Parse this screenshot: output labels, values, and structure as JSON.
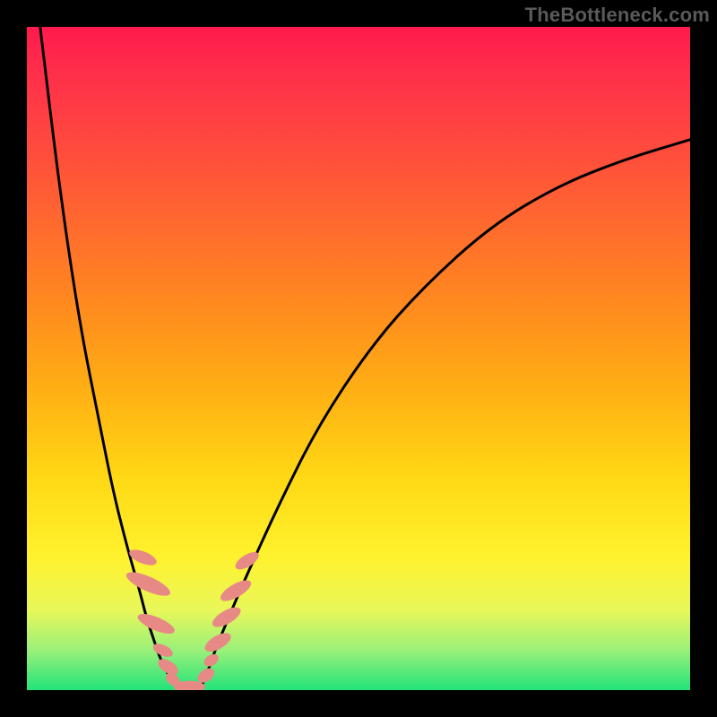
{
  "watermark": {
    "text": "TheBottleneck.com"
  },
  "chart_data": {
    "type": "line",
    "title": "",
    "xlabel": "",
    "ylabel": "",
    "xlim": [
      0,
      100
    ],
    "ylim": [
      0,
      100
    ],
    "grid": false,
    "legend": null,
    "series": [
      {
        "name": "left-branch-curve",
        "x": [
          2,
          5,
          8,
          11,
          13,
          15,
          17,
          18,
          19,
          20,
          21,
          22,
          23
        ],
        "y": [
          100,
          75,
          55,
          40,
          30,
          22,
          15,
          11,
          8,
          5,
          3,
          1,
          0
        ]
      },
      {
        "name": "right-branch-curve",
        "x": [
          26,
          27,
          28,
          30,
          33,
          38,
          44,
          52,
          60,
          70,
          80,
          90,
          100
        ],
        "y": [
          0,
          2,
          5,
          10,
          17,
          28,
          40,
          52,
          61,
          70,
          76,
          80,
          83
        ]
      }
    ],
    "markers": [
      {
        "name": "left-oval-1",
        "cx": 17.5,
        "cy": 20.0,
        "rx": 0.9,
        "ry": 2.2,
        "angle": -68
      },
      {
        "name": "left-oval-2",
        "cx": 18.3,
        "cy": 16.0,
        "rx": 1.1,
        "ry": 3.6,
        "angle": -66
      },
      {
        "name": "left-oval-3",
        "cx": 19.5,
        "cy": 10.0,
        "rx": 1.0,
        "ry": 3.0,
        "angle": -67
      },
      {
        "name": "left-oval-4",
        "cx": 20.5,
        "cy": 6.0,
        "rx": 0.8,
        "ry": 1.6,
        "angle": -65
      },
      {
        "name": "left-oval-5",
        "cx": 21.3,
        "cy": 3.5,
        "rx": 0.9,
        "ry": 1.7,
        "angle": -58
      },
      {
        "name": "left-oval-6",
        "cx": 22.0,
        "cy": 1.6,
        "rx": 0.8,
        "ry": 1.2,
        "angle": -50
      },
      {
        "name": "valley-oval",
        "cx": 24.5,
        "cy": 0.5,
        "rx": 2.4,
        "ry": 0.9,
        "angle": 0
      },
      {
        "name": "right-oval-1",
        "cx": 27.0,
        "cy": 2.2,
        "rx": 0.9,
        "ry": 1.4,
        "angle": 55
      },
      {
        "name": "right-oval-2",
        "cx": 27.8,
        "cy": 4.5,
        "rx": 0.8,
        "ry": 1.2,
        "angle": 58
      },
      {
        "name": "right-oval-3",
        "cx": 28.8,
        "cy": 7.2,
        "rx": 1.0,
        "ry": 2.2,
        "angle": 60
      },
      {
        "name": "right-oval-4",
        "cx": 30.1,
        "cy": 11.0,
        "rx": 1.0,
        "ry": 2.4,
        "angle": 60
      },
      {
        "name": "right-oval-5",
        "cx": 31.5,
        "cy": 15.0,
        "rx": 1.0,
        "ry": 2.6,
        "angle": 60
      },
      {
        "name": "right-oval-6",
        "cx": 33.2,
        "cy": 19.5,
        "rx": 0.9,
        "ry": 2.0,
        "angle": 58
      }
    ],
    "colors": {
      "curve": "#000000",
      "marker_fill": "#e78a86",
      "bg_top": "#ff1a4d",
      "bg_mid": "#ffd814",
      "bg_bottom": "#22e37a",
      "frame": "#000000"
    }
  }
}
